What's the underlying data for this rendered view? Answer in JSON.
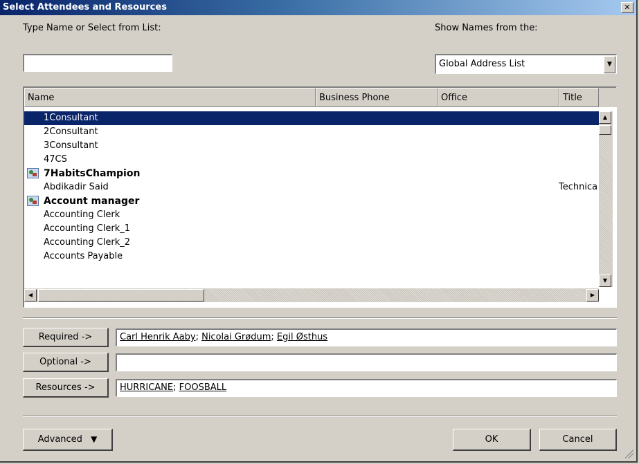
{
  "window": {
    "title": "Select Attendees and Resources",
    "close_glyph": "✕"
  },
  "search": {
    "label": "Type Name or Select from List:",
    "value": ""
  },
  "address_book": {
    "label": "Show Names from the:",
    "selected": "Global Address List"
  },
  "columns": [
    "Name",
    "Business Phone",
    "Office",
    "Title"
  ],
  "rows": [
    {
      "name": "1Consultant",
      "title": "",
      "bold": false,
      "icon": "",
      "selected": true
    },
    {
      "name": "2Consultant",
      "title": "",
      "bold": false,
      "icon": ""
    },
    {
      "name": "3Consultant",
      "title": "",
      "bold": false,
      "icon": ""
    },
    {
      "name": "47CS",
      "title": "",
      "bold": false,
      "icon": ""
    },
    {
      "name": "7HabitsChampion",
      "title": "",
      "bold": true,
      "icon": "distribution-list-icon"
    },
    {
      "name": "Abdikadir Said",
      "title": "Technica",
      "bold": false,
      "icon": ""
    },
    {
      "name": "Account manager",
      "title": "",
      "bold": true,
      "icon": "distribution-list-icon"
    },
    {
      "name": "Accounting Clerk",
      "title": "",
      "bold": false,
      "icon": ""
    },
    {
      "name": "Accounting Clerk_1",
      "title": "",
      "bold": false,
      "icon": ""
    },
    {
      "name": "Accounting Clerk_2",
      "title": "",
      "bold": false,
      "icon": ""
    },
    {
      "name": "Accounts Payable",
      "title": "",
      "bold": false,
      "icon": ""
    }
  ],
  "recipients": {
    "required": {
      "label": "Required ->",
      "entries": [
        "Carl Henrik Aaby",
        "Nicolai Grødum",
        "Egil Østhus"
      ]
    },
    "optional": {
      "label": "Optional ->",
      "entries": []
    },
    "resources": {
      "label": "Resources ->",
      "entries": [
        "HURRICANE",
        "FOOSBALL"
      ]
    }
  },
  "footer": {
    "advanced_label": "Advanced",
    "ok_label": "OK",
    "cancel_label": "Cancel"
  }
}
